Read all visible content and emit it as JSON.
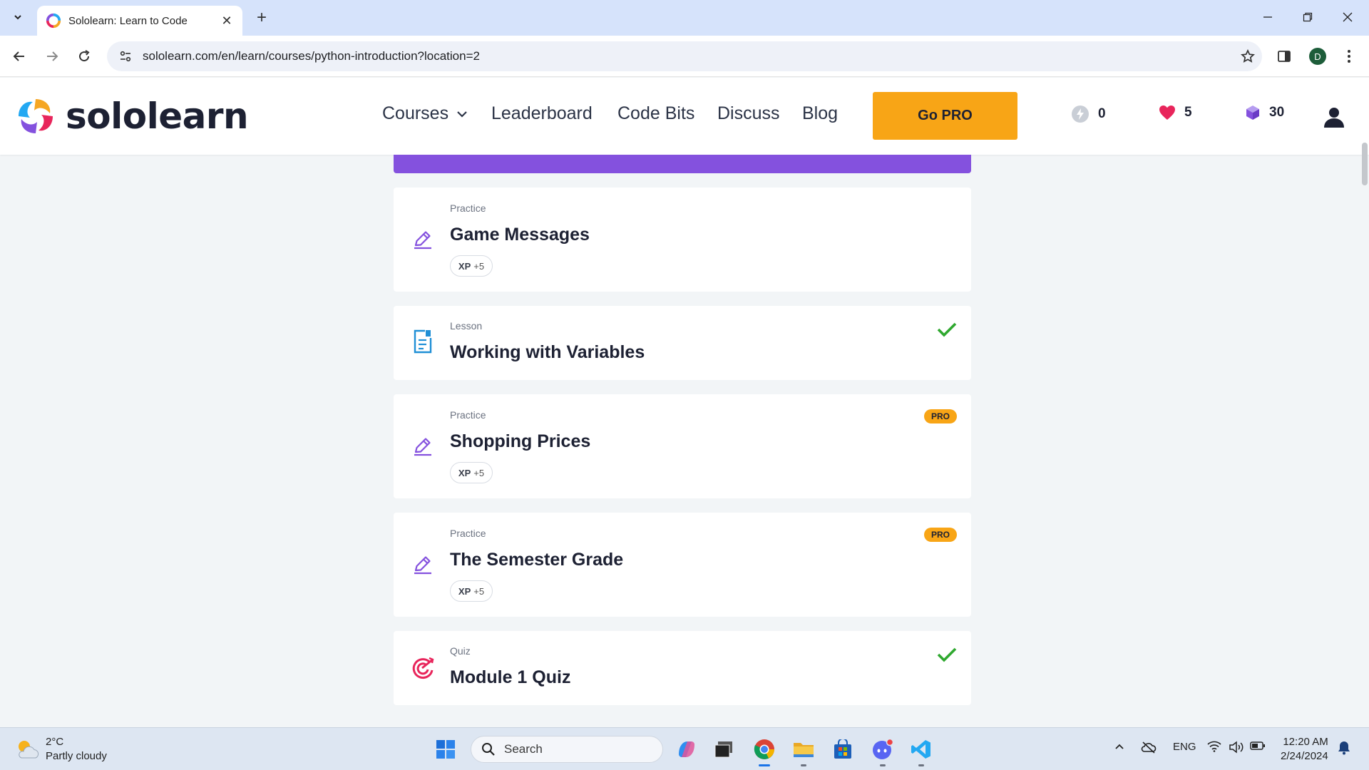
{
  "browser": {
    "tab_title": "Sololearn: Learn to Code",
    "url": "sololearn.com/en/learn/courses/python-introduction?location=2",
    "profile_initial": "D"
  },
  "header": {
    "logo_text": "sololearn",
    "nav": [
      "Courses",
      "Leaderboard",
      "Code Bits",
      "Discuss",
      "Blog"
    ],
    "go_pro": "Go PRO",
    "stats": {
      "streak": "0",
      "hearts": "5",
      "gems": "30"
    }
  },
  "cards": [
    {
      "type": "Practice",
      "title": "Game Messages",
      "xp_label": "XP",
      "xp_value": "+5",
      "icon": "pencil-icon",
      "pro": false,
      "completed": false
    },
    {
      "type": "Lesson",
      "title": "Working with Variables",
      "icon": "lesson-icon",
      "pro": false,
      "completed": true
    },
    {
      "type": "Practice",
      "title": "Shopping Prices",
      "xp_label": "XP",
      "xp_value": "+5",
      "icon": "pencil-icon",
      "pro": true,
      "pro_label": "PRO",
      "completed": false
    },
    {
      "type": "Practice",
      "title": "The Semester Grade",
      "xp_label": "XP",
      "xp_value": "+5",
      "icon": "pencil-icon",
      "pro": true,
      "pro_label": "PRO",
      "completed": false
    },
    {
      "type": "Quiz",
      "title": "Module 1 Quiz",
      "icon": "target-icon",
      "pro": false,
      "completed": true
    }
  ],
  "taskbar": {
    "weather_temp": "2°C",
    "weather_desc": "Partly cloudy",
    "search_label": "Search",
    "language": "ENG",
    "time": "12:20 AM",
    "date": "2/24/2024"
  },
  "colors": {
    "accent_purple": "#8451de",
    "pro_orange": "#f8a516",
    "check_green": "#2fa82f",
    "heart_red": "#e8255b"
  }
}
